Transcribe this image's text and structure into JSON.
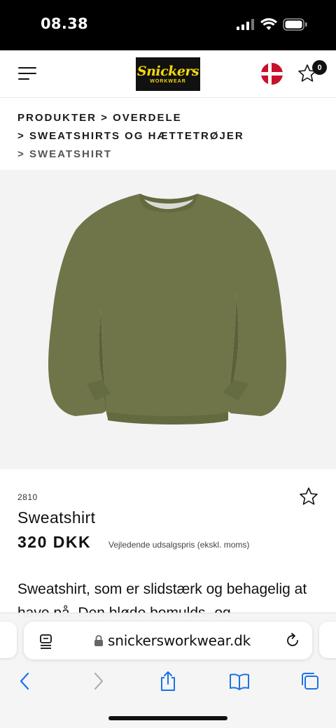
{
  "status_bar": {
    "time": "08.38"
  },
  "header": {
    "logo_text": "Snickers",
    "logo_subtext": "WORKWEAR",
    "favorites_count": "0"
  },
  "breadcrumb": [
    {
      "label": "PRODUKTER",
      "prefix": ""
    },
    {
      "label": "OVERDELE",
      "prefix": " > "
    },
    {
      "label": "SWEATSHIRTS OG HÆTTETRØJER",
      "prefix": "> "
    },
    {
      "label": "SWEATSHIRT",
      "prefix": "> "
    }
  ],
  "product": {
    "sku": "2810",
    "title": "Sweatshirt",
    "price": "320 DKK",
    "price_note": "Vejledende udsalgspris (ekskl. moms)",
    "description": "Sweatshirt, som er slidstærk og behagelig at have på. Den bløde bomulds- og",
    "image_color": "#6f7548"
  },
  "browser": {
    "url": "snickersworkwear.dk"
  },
  "colors": {
    "accent_yellow": "#f5d90a",
    "flag_red": "#c8102e",
    "ios_blue": "#1a73e8"
  }
}
